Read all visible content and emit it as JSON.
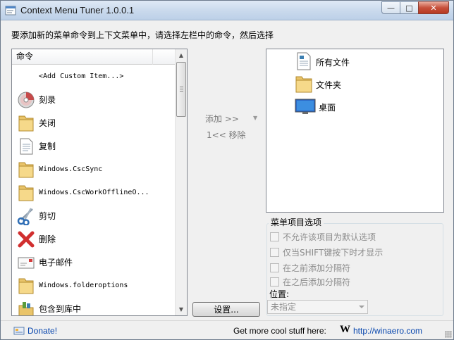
{
  "window": {
    "title": "Context Menu Tuner 1.0.0.1",
    "caption": {
      "minimize": "—",
      "maximize": "□",
      "close": "✕"
    }
  },
  "instruction": "要添加新的菜单命令到上下文菜单中，请选择左栏中的命令，然后选择",
  "commands": {
    "header": "命令",
    "items": [
      {
        "label": "<Add Custom Item...>",
        "icon": "none"
      },
      {
        "label": "刻录",
        "icon": "disc-icon"
      },
      {
        "label": "关闭",
        "icon": "folder-icon"
      },
      {
        "label": "复制",
        "icon": "document-icon"
      },
      {
        "label": "Windows.CscSync",
        "icon": "folder-icon"
      },
      {
        "label": "Windows.CscWorkOfflineO...",
        "icon": "folder-icon"
      },
      {
        "label": "剪切",
        "icon": "scissors-icon"
      },
      {
        "label": "删除",
        "icon": "delete-x-icon"
      },
      {
        "label": "电子邮件",
        "icon": "mail-icon"
      },
      {
        "label": "Windows.folderoptions",
        "icon": "folder-icon"
      },
      {
        "label": "包含到库中",
        "icon": "library-icon"
      }
    ]
  },
  "middle": {
    "add": "添加 >>",
    "remove": "1<< 移除"
  },
  "targets": [
    {
      "label": "所有文件",
      "icon": "file-icon"
    },
    {
      "label": "文件夹",
      "icon": "folder-icon"
    },
    {
      "label": "桌面",
      "icon": "desktop-icon"
    }
  ],
  "options": {
    "title": "菜单项目选项",
    "checkboxes": [
      "不允许该项目为默认选项",
      "仅当SHIFT键按下时才显示",
      "在之前添加分隔符",
      "在之后添加分隔符"
    ],
    "position_label": "位置:",
    "position_value": "未指定"
  },
  "settings_button": "设置...",
  "status": {
    "donate": "Donate!",
    "more": "Get more cool stuff here:",
    "logo": "W",
    "url": "http://winaero.com"
  },
  "colors": {
    "link": "#0645ad",
    "accent": "#3c7fb1"
  }
}
